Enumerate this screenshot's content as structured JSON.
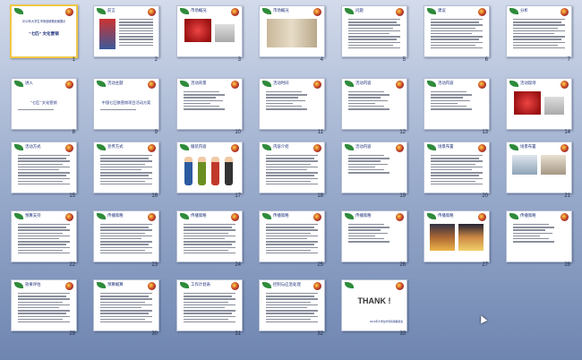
{
  "slides": [
    {
      "n": "1",
      "header": "",
      "title": "“七匹” 文化营销",
      "subtitle": "2012年大学生市场营销策划案展示",
      "kind": "cover",
      "selected": true
    },
    {
      "n": "2",
      "header": "前言",
      "kind": "text_img"
    },
    {
      "n": "3",
      "header": "市场概况",
      "kind": "photo_red"
    },
    {
      "n": "4",
      "header": "市场概况",
      "kind": "photo_map"
    },
    {
      "n": "5",
      "header": "问题",
      "kind": "text"
    },
    {
      "n": "6",
      "header": "建议",
      "kind": "text"
    },
    {
      "n": "7",
      "header": "分析",
      "kind": "text"
    },
    {
      "n": "8",
      "header": "进入",
      "title": "“七匹” 文化营销",
      "kind": "section"
    },
    {
      "n": "9",
      "header": "活动主题",
      "title": "中国七匹狼营销项目活动方案",
      "kind": "section"
    },
    {
      "n": "10",
      "header": "活动背景",
      "kind": "bullets"
    },
    {
      "n": "11",
      "header": "活动时间",
      "kind": "bullets"
    },
    {
      "n": "12",
      "header": "活动内容",
      "kind": "bullets"
    },
    {
      "n": "13",
      "header": "活动内容",
      "kind": "bullets"
    },
    {
      "n": "14",
      "header": "活动现场",
      "kind": "photo_red"
    },
    {
      "n": "15",
      "header": "活动方式",
      "kind": "text"
    },
    {
      "n": "16",
      "header": "宣传方式",
      "kind": "text"
    },
    {
      "n": "17",
      "header": "服装内容",
      "kind": "people"
    },
    {
      "n": "18",
      "header": "内容介绍",
      "kind": "text"
    },
    {
      "n": "19",
      "header": "活动内容",
      "kind": "bullets"
    },
    {
      "n": "20",
      "header": "场景布置",
      "kind": "text"
    },
    {
      "n": "21",
      "header": "场景布置",
      "kind": "photo_shop"
    },
    {
      "n": "22",
      "header": "预算支持",
      "kind": "text"
    },
    {
      "n": "23",
      "header": "传播策略",
      "kind": "text"
    },
    {
      "n": "24",
      "header": "传播策略",
      "kind": "text"
    },
    {
      "n": "25",
      "header": "传播策略",
      "kind": "text"
    },
    {
      "n": "26",
      "header": "传播策略",
      "kind": "bullets"
    },
    {
      "n": "27",
      "header": "传播策略",
      "kind": "photo_city"
    },
    {
      "n": "28",
      "header": "传播策略",
      "kind": "bullets"
    },
    {
      "n": "29",
      "header": "效果评估",
      "kind": "text"
    },
    {
      "n": "30",
      "header": "预算概算",
      "kind": "text"
    },
    {
      "n": "31",
      "header": "工作计划表",
      "kind": "text"
    },
    {
      "n": "32",
      "header": "控制与应急处理",
      "kind": "text"
    },
    {
      "n": "33",
      "header": "",
      "title": "THANK !",
      "subtitle": "2012年大学生市场营销策划案",
      "kind": "thanks"
    }
  ]
}
